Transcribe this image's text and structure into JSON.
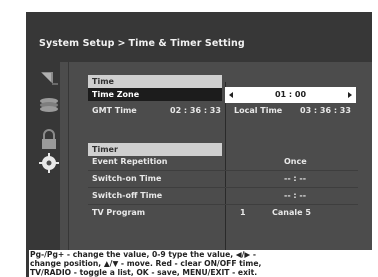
{
  "breadcrumb": {
    "root": "System Setup",
    "separator": ">",
    "current": "Time & Timer Setting"
  },
  "icons": [
    "satellite-dish-icon",
    "stack-layers-icon",
    "padlock-icon",
    "gear-icon"
  ],
  "time_section": {
    "header": "Time",
    "time_zone_label": "Time Zone",
    "time_zone_value": "01 : 00",
    "gmt_time_label": "GMT Time",
    "gmt_time_value": "02 : 36 : 33",
    "local_time_label": "Local Time",
    "local_time_value": "03 : 36 : 33"
  },
  "timer_section": {
    "header": "Timer",
    "event_repetition_label": "Event Repetition",
    "event_repetition_value": "Once",
    "switch_on_label": "Switch-on Time",
    "switch_on_value": "-- : --",
    "switch_off_label": "Switch-off Time",
    "switch_off_value": "-- : --",
    "tv_program_label": "TV Program",
    "tv_program_number": "1",
    "tv_program_name": "Canale 5"
  },
  "help": {
    "line1": "Pg-/Pg+ - change the value, 0-9 type the value, ◀/▶ -",
    "line2": "change position, ▲/▼ - move. Red - clear ON/OFF time,",
    "line3": "TV/RADIO - toggle a list, OK - save, MENU/EXIT - exit."
  },
  "colors": {
    "background": "#373737",
    "menu_panel": "#4c4c4c",
    "section_header": "#cfcfcf",
    "selected_row": "#1c1c1c",
    "value_box": "#ffffff"
  }
}
